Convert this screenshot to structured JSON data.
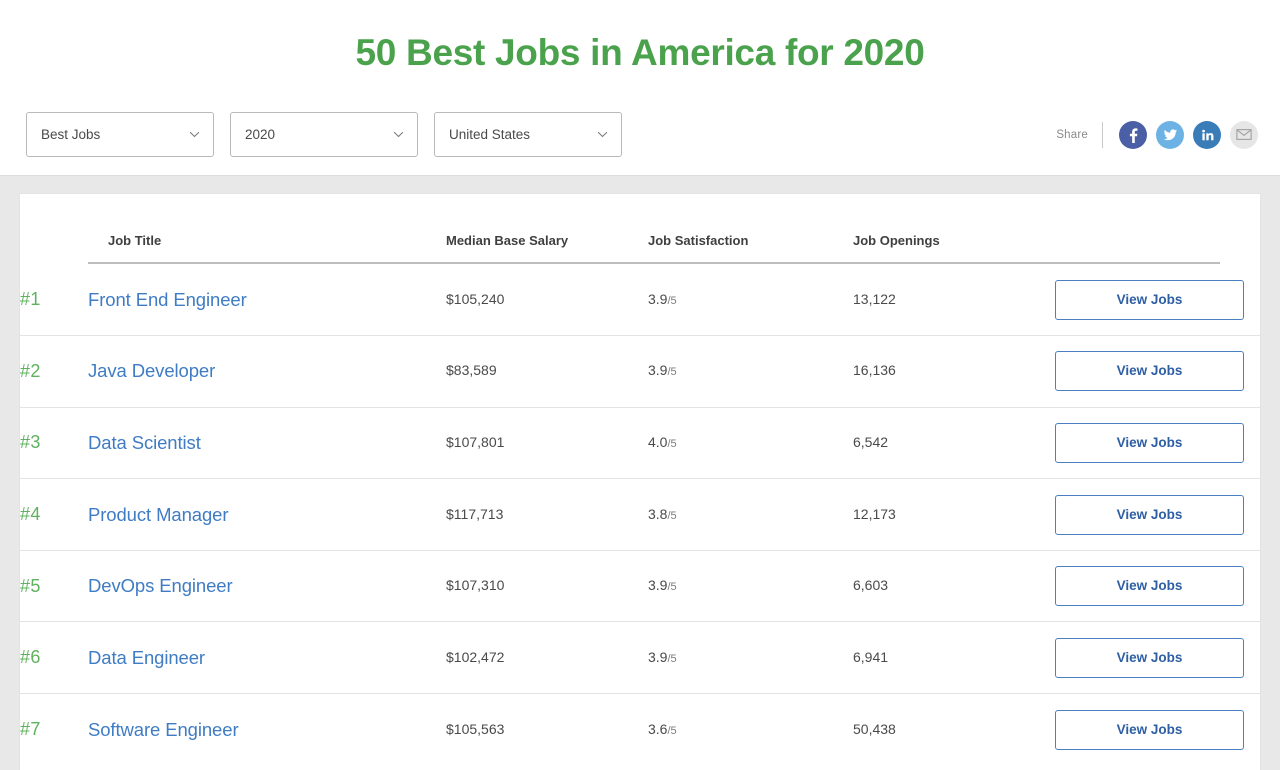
{
  "header": {
    "title": "50 Best Jobs in America for 2020",
    "title_color": "#4ba24d"
  },
  "filters": [
    {
      "name": "category",
      "value": "Best Jobs",
      "icon": "chevron-down-icon"
    },
    {
      "name": "year",
      "value": "2020",
      "icon": "chevron-down-icon"
    },
    {
      "name": "country",
      "value": "United States",
      "icon": "chevron-down-icon"
    }
  ],
  "share": {
    "label": "Share",
    "icons": [
      {
        "name": "facebook-icon",
        "color": "#4a5fa5"
      },
      {
        "name": "twitter-icon",
        "color": "#6cb2e4"
      },
      {
        "name": "linkedin-icon",
        "color": "#3a7cb8"
      },
      {
        "name": "email-icon",
        "color": "#e3e3e3"
      }
    ]
  },
  "table": {
    "columns": [
      "",
      "Job Title",
      "Median Base Salary",
      "Job Satisfaction",
      "Job Openings",
      ""
    ],
    "button_label": "View Jobs",
    "rows": [
      {
        "rank": "#1",
        "title": "Front End Engineer",
        "salary": "$105,240",
        "satisfaction": "3.9",
        "satisfaction_denom": "/5",
        "openings": "13,122",
        "button": "View Jobs"
      },
      {
        "rank": "#2",
        "title": "Java Developer",
        "salary": "$83,589",
        "satisfaction": "3.9",
        "satisfaction_denom": "/5",
        "openings": "16,136",
        "button": "View Jobs"
      },
      {
        "rank": "#3",
        "title": "Data Scientist",
        "salary": "$107,801",
        "satisfaction": "4.0",
        "satisfaction_denom": "/5",
        "openings": "6,542",
        "button": "View Jobs"
      },
      {
        "rank": "#4",
        "title": "Product Manager",
        "salary": "$117,713",
        "satisfaction": "3.8",
        "satisfaction_denom": "/5",
        "openings": "12,173",
        "button": "View Jobs"
      },
      {
        "rank": "#5",
        "title": "DevOps Engineer",
        "salary": "$107,310",
        "satisfaction": "3.9",
        "satisfaction_denom": "/5",
        "openings": "6,603",
        "button": "View Jobs"
      },
      {
        "rank": "#6",
        "title": "Data Engineer",
        "salary": "$102,472",
        "satisfaction": "3.9",
        "satisfaction_denom": "/5",
        "openings": "6,941",
        "button": "View Jobs"
      },
      {
        "rank": "#7",
        "title": "Software Engineer",
        "salary": "$105,563",
        "satisfaction": "3.6",
        "satisfaction_denom": "/5",
        "openings": "50,438",
        "button": "View Jobs"
      }
    ]
  }
}
